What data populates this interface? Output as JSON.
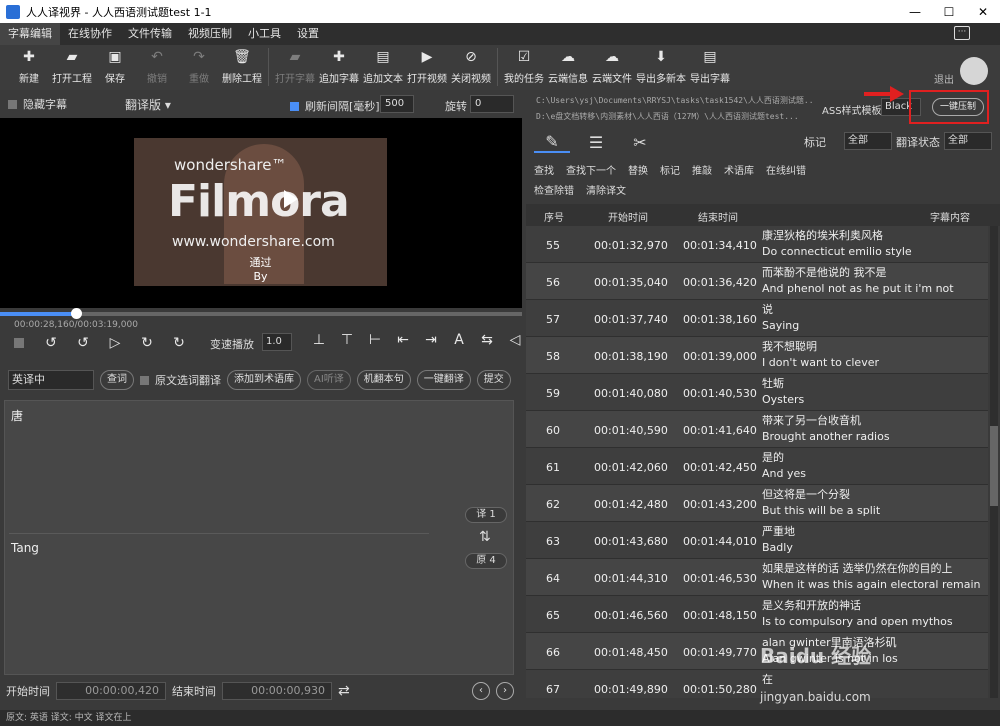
{
  "window": {
    "title": "人人译视界 - 人人西语测试题test 1-1",
    "minimize": "—",
    "maximize": "☐",
    "close": "✕"
  },
  "menu": [
    "字幕编辑",
    "在线协作",
    "文件传输",
    "视频压制",
    "小工具",
    "设置"
  ],
  "toolbar": [
    {
      "label": "新建",
      "icon": "✚",
      "icon_name": "new-file-icon",
      "enabled": true
    },
    {
      "label": "打开工程",
      "icon": "▰",
      "icon_name": "folder-icon",
      "enabled": true
    },
    {
      "label": "保存",
      "icon": "▣",
      "icon_name": "save-icon",
      "enabled": true
    },
    {
      "label": "撤销",
      "icon": "↶",
      "icon_name": "undo-icon",
      "enabled": false
    },
    {
      "label": "重做",
      "icon": "↷",
      "icon_name": "redo-icon",
      "enabled": false
    },
    {
      "label": "删除工程",
      "icon": "🗑",
      "icon_name": "trash-icon",
      "enabled": true
    },
    {
      "label": "打开字幕",
      "icon": "▰",
      "icon_name": "open-subtitle-icon",
      "enabled": false
    },
    {
      "label": "追加字幕",
      "icon": "✚",
      "icon_name": "add-subtitle-icon",
      "enabled": true
    },
    {
      "label": "追加文本",
      "icon": "▤",
      "icon_name": "add-text-icon",
      "enabled": true
    },
    {
      "label": "打开视频",
      "icon": "▶",
      "icon_name": "video-icon",
      "enabled": true
    },
    {
      "label": "关闭视频",
      "icon": "⊘",
      "icon_name": "close-video-icon",
      "enabled": true
    },
    {
      "label": "我的任务",
      "icon": "☑",
      "icon_name": "task-icon",
      "enabled": true
    },
    {
      "label": "云端信息",
      "icon": "☁",
      "icon_name": "cloud-info-icon",
      "enabled": true
    },
    {
      "label": "云端文件",
      "icon": "☁",
      "icon_name": "cloud-file-icon",
      "enabled": true
    },
    {
      "label": "导出多新本",
      "icon": "⬇",
      "icon_name": "export-multi-icon",
      "enabled": true
    },
    {
      "label": "导出字幕",
      "icon": "▤",
      "icon_name": "export-subtitle-icon",
      "enabled": true
    }
  ],
  "user": {
    "logout": "退出"
  },
  "left": {
    "hide_subtitles": "隐藏字幕",
    "mode": "翻译版 ▾",
    "refresh_label": "刷新间隔[毫秒]",
    "refresh_value": "500",
    "rotate_label": "旋转",
    "rotate_value": "0",
    "video": {
      "brand": "wondershare™",
      "logo": "Filmora",
      "site": "www.wondershare.com",
      "sub_zh": "通过",
      "sub_en": "By"
    },
    "progress": 0.1464,
    "time": "00:00:28,160/00:03:19,000",
    "speed_label": "变速播放",
    "speed_value": "1.0",
    "trans_lang": "英译中",
    "btn_lookup": "查词",
    "original_select": "原文选词翻译",
    "btn_add_glossary": "添加到术语库",
    "btn_ai": "AI听译",
    "btn_mt_sentence": "机翻本句",
    "btn_one_click": "一键翻译",
    "btn_submit": "提交",
    "edit_zh": "唐",
    "edit_en": "Tang",
    "tag_trans": "译 1",
    "tag_orig": "原 4",
    "start_label": "开始时间",
    "start_value": "00:00:00,420",
    "end_label": "结束时间",
    "end_value": "00:00:00,930"
  },
  "status": "原文: 英语  译文: 中文    译文在上",
  "right": {
    "path1": "C:\\Users\\ysj\\Documents\\RRYSJ\\tasks\\task1542\\人人西语测试题...",
    "path2": "D:\\e盘文档转移\\内测素材\\人人西语（127M）\\人人西语测试题test...",
    "ass_label": "ASS样式模板",
    "ass_value": "Black",
    "one_click_burn": "一键压制",
    "filter_mark_label": "标记",
    "filter_mark_value": "全部",
    "filter_state_label": "翻译状态",
    "filter_state_value": "全部",
    "tools1": [
      "查找",
      "查找下一个",
      "替换",
      "标记",
      "推敲",
      "术语库",
      "在线纠错"
    ],
    "tools2": [
      "检查除错",
      "清除译文"
    ],
    "headers": [
      "序号",
      "开始时间",
      "结束时间",
      "字幕内容"
    ],
    "rows": [
      {
        "n": "55",
        "start": "00:01:32,970",
        "end": "00:01:34,410",
        "zh": "康涅狄格的埃米利奥风格",
        "en": "Do connecticut emilio style"
      },
      {
        "n": "56",
        "start": "00:01:35,040",
        "end": "00:01:36,420",
        "zh": "而苯酚不是他说的  我不是",
        "en": "And phenol not as he put it i'm not"
      },
      {
        "n": "57",
        "start": "00:01:37,740",
        "end": "00:01:38,160",
        "zh": "说",
        "en": "Saying"
      },
      {
        "n": "58",
        "start": "00:01:38,190",
        "end": "00:01:39,000",
        "zh": "我不想聪明",
        "en": "I don't want to clever"
      },
      {
        "n": "59",
        "start": "00:01:40,080",
        "end": "00:01:40,530",
        "zh": "牡蛎",
        "en": "Oysters"
      },
      {
        "n": "60",
        "start": "00:01:40,590",
        "end": "00:01:41,640",
        "zh": "带来了另一台收音机",
        "en": "Brought another radios"
      },
      {
        "n": "61",
        "start": "00:01:42,060",
        "end": "00:01:42,450",
        "zh": "是的",
        "en": "And yes"
      },
      {
        "n": "62",
        "start": "00:01:42,480",
        "end": "00:01:43,200",
        "zh": "但这将是一个分裂",
        "en": "But this will be a split"
      },
      {
        "n": "63",
        "start": "00:01:43,680",
        "end": "00:01:44,010",
        "zh": "严重地",
        "en": "Badly"
      },
      {
        "n": "64",
        "start": "00:01:44,310",
        "end": "00:01:46,530",
        "zh": "如果是这样的话  选举仍然在你的目的上",
        "en": "When it was this again electoral remain"
      },
      {
        "n": "65",
        "start": "00:01:46,560",
        "end": "00:01:48,150",
        "zh": "是义务和开放的神话",
        "en": "Is to compulsory and open mythos"
      },
      {
        "n": "66",
        "start": "00:01:48,450",
        "end": "00:01:49,770",
        "zh": "alan gwinter里南语洛杉矶",
        "en": "Alan gwinter is not in los"
      },
      {
        "n": "67",
        "start": "00:01:49,890",
        "end": "00:01:50,280",
        "zh": "在",
        "en": ""
      }
    ]
  },
  "watermark": {
    "logo": "Baidu 经验",
    "url": "jingyan.baidu.com"
  },
  "colors": {
    "accent": "#4a8ef5",
    "highlight": "#e02020"
  }
}
